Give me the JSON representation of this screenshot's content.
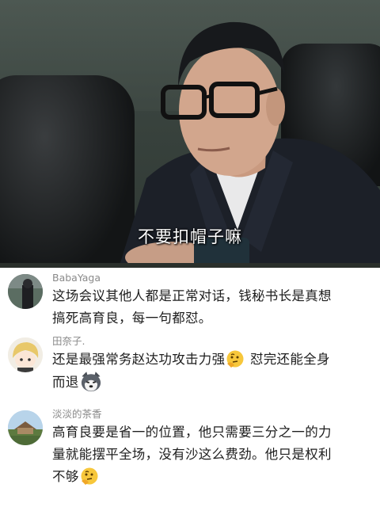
{
  "video": {
    "subtitle": "不要扣帽子嘛"
  },
  "comments": [
    {
      "username": "BabaYaga",
      "lines": [
        "这场会议其他人都是正常对话，钱秘书长是真想",
        "搞死高育良，每一句都怼。"
      ]
    },
    {
      "username": "田奈子.",
      "line1": "还是最强常务赵达功攻击力强",
      "line1_after": " 怼完还能全身",
      "line2": "而退",
      "emoji1": "thinking-face-emoji",
      "emoji2": "husky-dog-emoji"
    },
    {
      "username": "淡淡的茶香",
      "lines": [
        "高育良要是省一的位置，他只需要三分之一的力",
        "量就能摆平全场，没有沙这么费劲。他只是权利"
      ],
      "last_line": "不够",
      "emoji": "thinking-face-emoji"
    }
  ]
}
